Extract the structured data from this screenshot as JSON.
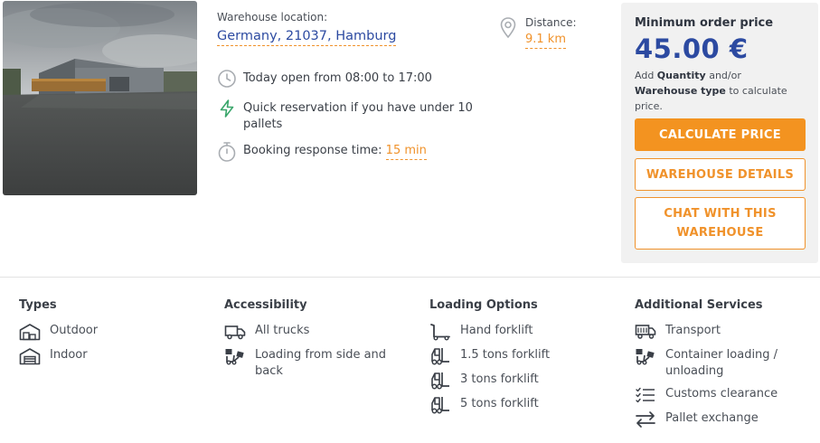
{
  "listing": {
    "location_label": "Warehouse location:",
    "location_value": "Germany, 21037, Hamburg",
    "open_text": "Today open from 08:00 to 17:00",
    "quick_reservation_text": "Quick reservation if you have under 10 pallets",
    "booking_label": "Booking response time:",
    "booking_value": "15 min",
    "distance_label": "Distance:",
    "distance_value": "9.1 km"
  },
  "price": {
    "label": "Minimum order price",
    "value": "45.00 €",
    "note_prefix": "Add ",
    "note_quantity": "Quantity",
    "note_middle": " and/or ",
    "note_warehouse_type": "Warehouse type",
    "note_suffix": " to calculate price.",
    "calculate_button": "CALCULATE PRICE",
    "details_button": "WAREHOUSE DETAILS",
    "chat_button": "CHAT WITH THIS WAREHOUSE"
  },
  "columns": {
    "types": {
      "title": "Types",
      "items": [
        {
          "label": "Outdoor",
          "icon": "outdoor-storage-icon"
        },
        {
          "label": "Indoor",
          "icon": "indoor-storage-icon"
        }
      ]
    },
    "accessibility": {
      "title": "Accessibility",
      "items": [
        {
          "label": "All trucks",
          "icon": "truck-icon"
        },
        {
          "label": "Loading from side and back",
          "icon": "forklift-loading-icon"
        }
      ]
    },
    "loading": {
      "title": "Loading Options",
      "items": [
        {
          "label": "Hand forklift",
          "icon": "hand-forklift-icon"
        },
        {
          "label": "1.5 tons forklift",
          "icon": "forklift-icon"
        },
        {
          "label": "3 tons forklift",
          "icon": "forklift-icon"
        },
        {
          "label": "5 tons forklift",
          "icon": "forklift-icon"
        }
      ]
    },
    "services": {
      "title": "Additional Services",
      "items": [
        {
          "label": "Transport",
          "icon": "transport-truck-icon"
        },
        {
          "label": "Container loading / unloading",
          "icon": "container-loading-icon"
        },
        {
          "label": "Customs clearance",
          "icon": "checklist-icon"
        },
        {
          "label": "Pallet exchange",
          "icon": "exchange-arrows-icon"
        }
      ]
    }
  },
  "colors": {
    "accent": "#f39320",
    "brand_blue": "#2c4aa1",
    "panel_bg": "#f1f1f1"
  }
}
